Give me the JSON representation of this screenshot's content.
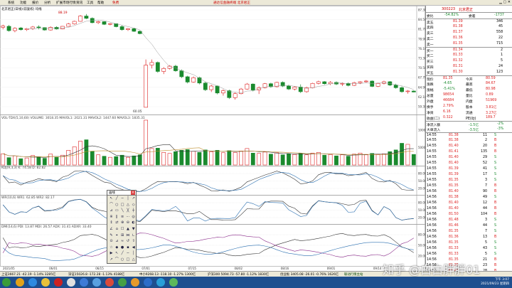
{
  "menu": {
    "items": [
      "系统",
      "功能",
      "报价",
      "分析",
      "扩展市场行情",
      "资讯",
      "工具",
      "帮助",
      "免费"
    ],
    "brand": "通达信金融终端 北京君正"
  },
  "colors": {
    "up": "#d22",
    "down": "#1a8a2e",
    "ma": "#333",
    "accent": "#c00"
  },
  "chart": {
    "title": "北京君正(日线)(前复权)  均线",
    "indicator_vol": "VOL-TDX(5,10,60)  VOLUME: 3018.35  MAVOL1: 2021.31  MAVOL2: 1447.60  MAVOL3: 1835.31",
    "indicator_kdj": "KDJ(9,3,3)  K: 74.58  D: 82.82",
    "indicator_wr": "WR(10,6)  WR1: 62.85  WR2: 82.17",
    "indicator_dmi": "DMI(14,6)  PDI: 13.87  MDI: 26.57  ADX: 31.41  ADXR: 33.40",
    "price_axis": [
      "87.30",
      "84.50",
      "81.70",
      "78.90",
      "76.10",
      "73.30",
      "70.50",
      "67.70",
      "64.90",
      "62.10",
      "59.30"
    ],
    "vol_axis": [
      "10000",
      "5000"
    ],
    "osc_axis": [
      "80.00",
      "50.00",
      "20.00"
    ],
    "high_label": "88.19",
    "low_label": "60.05",
    "dates": [
      "2021/05",
      "06/01",
      "06/15",
      "07/01",
      "07/15",
      "08/02",
      "08/16",
      "09/01",
      "09/14"
    ],
    "candles": [
      [
        84.2,
        85.0,
        83.6,
        84.6
      ],
      [
        84.5,
        84.9,
        82.9,
        83.2
      ],
      [
        83.2,
        84.2,
        82.7,
        83.9
      ],
      [
        84.0,
        84.3,
        83.2,
        83.5
      ],
      [
        83.5,
        84.0,
        83.1,
        83.8
      ],
      [
        83.8,
        84.6,
        83.4,
        84.3
      ],
      [
        84.3,
        84.8,
        83.6,
        84.1
      ],
      [
        84.1,
        84.2,
        83.2,
        83.4
      ],
      [
        83.4,
        84.5,
        83.2,
        84.2
      ],
      [
        84.2,
        84.5,
        83.5,
        83.7
      ],
      [
        83.7,
        84.6,
        83.6,
        84.5
      ],
      [
        84.5,
        85.5,
        84.4,
        85.2
      ],
      [
        85.2,
        86.2,
        85.0,
        86.0
      ],
      [
        86.0,
        87.9,
        85.9,
        87.6
      ],
      [
        87.6,
        88.2,
        86.7,
        86.9
      ],
      [
        86.9,
        87.2,
        85.4,
        85.6
      ],
      [
        85.6,
        86.2,
        85.2,
        85.9
      ],
      [
        85.9,
        86.0,
        84.9,
        85.1
      ],
      [
        85.1,
        85.5,
        84.8,
        85.3
      ],
      [
        85.3,
        85.4,
        84.2,
        84.4
      ],
      [
        84.4,
        84.8,
        83.2,
        83.5
      ],
      [
        83.5,
        84.0,
        83.1,
        83.8
      ],
      [
        83.8,
        84.0,
        82.8,
        83.0
      ],
      [
        83.0,
        83.2,
        82.1,
        82.3
      ],
      [
        60.1,
        74.5,
        60.05,
        72.8
      ],
      [
        72.8,
        74.5,
        71.8,
        73.6
      ],
      [
        73.6,
        73.9,
        70.5,
        70.9
      ],
      [
        70.9,
        72.2,
        70.1,
        71.8
      ],
      [
        71.8,
        72.8,
        71.5,
        72.5
      ],
      [
        72.5,
        72.9,
        70.8,
        71.1
      ],
      [
        71.1,
        71.5,
        68.9,
        69.3
      ],
      [
        69.3,
        69.6,
        67.3,
        67.7
      ],
      [
        67.7,
        69.4,
        67.5,
        69.0
      ],
      [
        69.0,
        69.3,
        67.0,
        67.4
      ],
      [
        67.4,
        67.8,
        65.0,
        65.4
      ],
      [
        65.4,
        66.9,
        64.7,
        66.5
      ],
      [
        66.5,
        66.7,
        64.0,
        64.4
      ],
      [
        64.4,
        65.5,
        63.6,
        65.1
      ],
      [
        65.1,
        65.4,
        62.6,
        63.0
      ],
      [
        63.0,
        64.6,
        62.4,
        64.2
      ],
      [
        64.2,
        65.9,
        64.0,
        65.6
      ],
      [
        65.6,
        67.4,
        65.4,
        67.1
      ],
      [
        67.1,
        67.3,
        64.9,
        65.3
      ],
      [
        65.3,
        66.4,
        64.1,
        66.0
      ],
      [
        66.0,
        67.4,
        65.8,
        67.2
      ],
      [
        67.2,
        67.5,
        66.0,
        66.3
      ],
      [
        66.3,
        67.8,
        66.1,
        67.6
      ],
      [
        67.6,
        67.9,
        66.2,
        66.5
      ],
      [
        66.5,
        66.9,
        65.3,
        65.6
      ],
      [
        65.6,
        66.5,
        65.2,
        66.2
      ],
      [
        66.2,
        67.0,
        64.4,
        64.8
      ],
      [
        64.8,
        66.3,
        64.5,
        66.0
      ],
      [
        66.0,
        67.5,
        65.8,
        67.3
      ],
      [
        67.3,
        68.1,
        67.0,
        67.8
      ],
      [
        67.8,
        68.0,
        66.9,
        67.2
      ],
      [
        67.2,
        68.0,
        66.8,
        67.6
      ],
      [
        67.6,
        67.9,
        66.8,
        67.1
      ],
      [
        67.1,
        67.6,
        66.5,
        67.3
      ],
      [
        67.3,
        67.6,
        66.4,
        66.7
      ],
      [
        66.7,
        67.8,
        66.5,
        67.5
      ],
      [
        67.5,
        68.0,
        67.1,
        67.8
      ],
      [
        67.8,
        68.3,
        67.5,
        68.0
      ],
      [
        68.0,
        68.2,
        66.2,
        66.4
      ],
      [
        66.4,
        67.5,
        66.2,
        67.3
      ],
      [
        67.3,
        68.1,
        67.0,
        67.8
      ],
      [
        67.8,
        68.0,
        66.5,
        66.8
      ],
      [
        66.8,
        67.2,
        65.7,
        66.0
      ],
      [
        66.0,
        66.4,
        64.5,
        64.8
      ],
      [
        64.8,
        65.3,
        64.2,
        65.0
      ],
      [
        65.0,
        65.2,
        64.6,
        64.7
      ]
    ],
    "volumes": [
      3200,
      2100,
      2600,
      1800,
      2000,
      2700,
      2300,
      1900,
      3100,
      2200,
      2800,
      4200,
      5200,
      6800,
      7200,
      3900,
      2900,
      2500,
      2200,
      2400,
      2800,
      2200,
      2600,
      2900,
      12800,
      4700,
      4800,
      3600,
      3300,
      3800,
      4200,
      4400,
      3900,
      3600,
      4300,
      3800,
      4200,
      3500,
      4100,
      3600,
      4000,
      4700,
      3400,
      3300,
      3700,
      3100,
      3500,
      2900,
      3200,
      3000,
      3300,
      2900,
      3400,
      3600,
      2800,
      3000,
      2600,
      2900,
      2500,
      3100,
      3400,
      2900,
      3300,
      3000,
      3200,
      3800,
      4300,
      6200,
      5900,
      3018
    ]
  },
  "quote": {
    "code": "300223",
    "name": "北京君正",
    "top": [
      [
        "委比",
        "-54.82%",
        "委差",
        "-1737"
      ]
    ],
    "asks": [
      [
        "卖五",
        "81.39",
        "346"
      ],
      [
        "卖四",
        "81.38",
        "45"
      ],
      [
        "卖三",
        "81.37",
        "558"
      ],
      [
        "卖二",
        "81.36",
        "22"
      ],
      [
        "卖一",
        "81.35",
        "715"
      ]
    ],
    "bids": [
      [
        "买一",
        "81.34",
        "2"
      ],
      [
        "买二",
        "81.33",
        "1"
      ],
      [
        "买三",
        "81.32",
        "5"
      ],
      [
        "买四",
        "81.31",
        "24"
      ],
      [
        "买五",
        "81.30",
        "123"
      ]
    ],
    "stats": [
      [
        "现价",
        "81.35",
        "今开",
        "80.59"
      ],
      [
        "涨跌",
        "-4.65",
        "最高",
        "84.67"
      ],
      [
        "涨幅",
        "-5.41%",
        "最低",
        "80.98"
      ],
      [
        "总量",
        "98654",
        "量比",
        "0.89"
      ],
      [
        "外盘",
        "46684",
        "内盘",
        "51969"
      ],
      [
        "换手",
        "2.79%",
        "股本",
        "3.81亿"
      ],
      [
        "净资",
        "6.16",
        "流通",
        "3.27亿"
      ],
      [
        "收益(二)",
        "0.322",
        "PE(动)",
        "189.7"
      ]
    ],
    "flow": [
      [
        "净流入额",
        "-1.5亿",
        "-2%"
      ],
      [
        "大单流入",
        "-3.5亿",
        "-3%"
      ]
    ],
    "ticks": [
      [
        "14:55",
        "81.38",
        "11",
        "S"
      ],
      [
        "14:55",
        "81.38",
        "2",
        "B"
      ],
      [
        "14:55",
        "81.40",
        "20",
        "B"
      ],
      [
        "14:55",
        "81.41",
        "135",
        "B"
      ],
      [
        "14:55",
        "81.40",
        "29",
        "S"
      ],
      [
        "14:55",
        "81.40",
        "52",
        "S"
      ],
      [
        "14:55",
        "81.39",
        "41",
        "S"
      ],
      [
        "14:55",
        "81.39",
        "17",
        "S"
      ],
      [
        "14:55",
        "81.35",
        "3",
        "S"
      ],
      [
        "14:55",
        "81.35",
        "7",
        "B"
      ],
      [
        "14:56",
        "81.40",
        "90",
        "B"
      ],
      [
        "14:56",
        "81.38",
        "49",
        "S"
      ],
      [
        "14:56",
        "81.40",
        "12",
        "B"
      ],
      [
        "14:56",
        "81.40",
        "44",
        "B"
      ],
      [
        "14:56",
        "81.50",
        "104",
        "B"
      ],
      [
        "14:56",
        "81.48",
        "3",
        "S"
      ],
      [
        "14:56",
        "81.46",
        "44",
        "S"
      ],
      [
        "14:56",
        "81.35",
        "7",
        "S"
      ],
      [
        "14:56",
        "81.36",
        "13",
        "B"
      ],
      [
        "14:56",
        "81.35",
        "5",
        "S"
      ],
      [
        "14:56",
        "81.33",
        "43",
        "S"
      ],
      [
        "14:56",
        "81.33",
        "5",
        "S"
      ],
      [
        "14:56",
        "81.35",
        "21",
        "B"
      ],
      [
        "14:56",
        "81.35",
        "23",
        "B"
      ],
      [
        "14:56",
        "81.40",
        "28",
        "B"
      ],
      [
        "14:57",
        "81.40",
        "19",
        "B"
      ],
      [
        "14:57",
        "81.35",
        "7",
        "S"
      ]
    ]
  },
  "status": {
    "items": [
      "上证3667.21 -42.19 -1.14% 3285亿",
      "深证15026.8 -172.28 -1.13% 4188亿",
      "中小9268.13 -118.10 -1.27% 1300亿",
      "沪深300 5094.73 -57.80 -1.12% 1830亿",
      "创业板 3405.08 -26.01 -0.76% 1626亿"
    ],
    "right": "联动行情主站"
  },
  "tools": {
    "title": "画线"
  },
  "taskbar": {
    "time": "下午 3:07",
    "date": "2021/09/23 星期四"
  },
  "watermark": "知乎 @白白胖胖01"
}
